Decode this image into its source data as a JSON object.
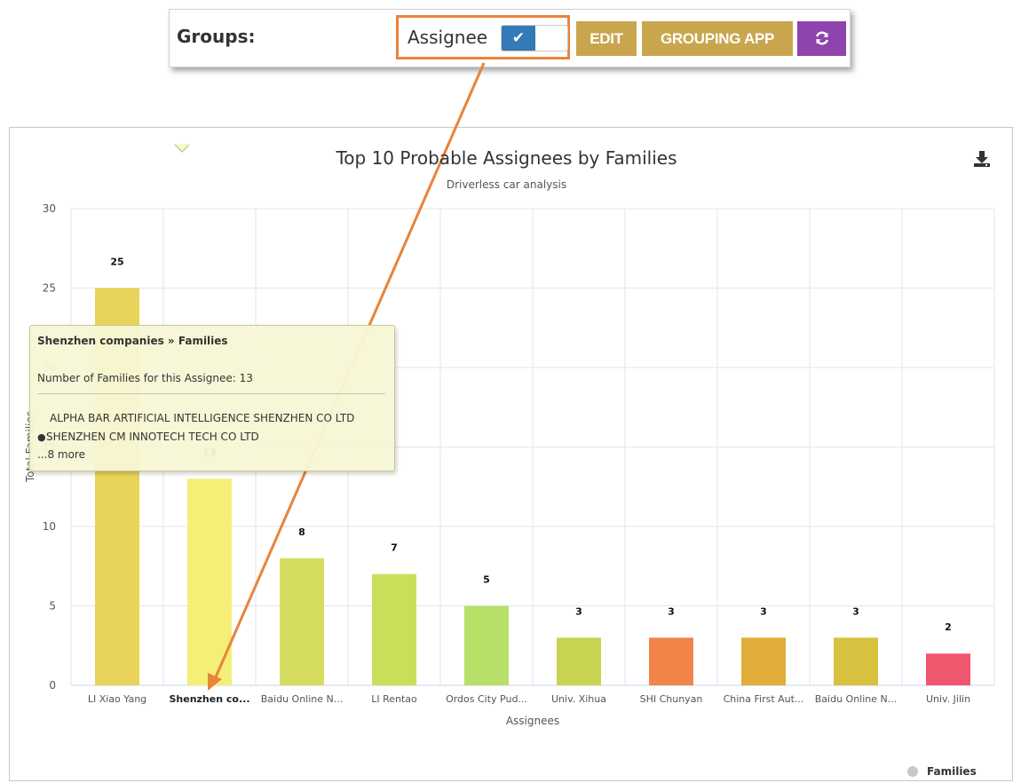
{
  "toolbar": {
    "groups_label": "Groups:",
    "assignee_label": "Assignee",
    "toggle_state": "on",
    "edit_label": "EDIT",
    "grouping_app_label": "GROUPING APP",
    "refresh_icon": "refresh-icon",
    "colors": {
      "gold_button": "#c9a54e",
      "purple_button": "#8e44ad",
      "toggle_blue": "#337ab7",
      "highlight_orange": "#e8833a"
    }
  },
  "chart_data": {
    "type": "bar",
    "title": "Top 10 Probable Assignees by Families",
    "subtitle": "Driverless car analysis",
    "xlabel": "Assignees",
    "ylabel": "Total Families",
    "ylim": [
      0,
      30
    ],
    "yticks": [
      "0",
      "5",
      "10",
      "15",
      "20",
      "25",
      "30"
    ],
    "grid": true,
    "legend_position": "bottom-right",
    "categories": [
      "LI Xiao Yang",
      "Shenzhen co...",
      "Baidu Online N...",
      "LI Rentao",
      "Ordos City Pud...",
      "Univ. Xihua",
      "SHI Chunyan",
      "China First Aut...",
      "Baidu Online N...",
      "Univ. Jilin"
    ],
    "highlighted_category": 1,
    "series": [
      {
        "name": "Families",
        "values": [
          25,
          13,
          8,
          7,
          5,
          3,
          3,
          3,
          3,
          2
        ],
        "colors": [
          "#e8d45a",
          "#f5ef78",
          "#d6dc5e",
          "#c9df5a",
          "#b8e068",
          "#c9d352",
          "#f2844a",
          "#e2ac3a",
          "#d7c13e",
          "#f0566e"
        ]
      }
    ]
  },
  "tooltip": {
    "header": "Shenzhen companies » Families",
    "count_text": "Number of Families for this Assignee: 13",
    "line1": "ALPHA BAR ARTIFICIAL INTELLIGENCE SHENZHEN CO LTD",
    "line2": "SHENZHEN CM INNOTECH TECH CO LTD",
    "more": "...8 more"
  },
  "download_icon": "download-icon",
  "legend_label": "Families"
}
